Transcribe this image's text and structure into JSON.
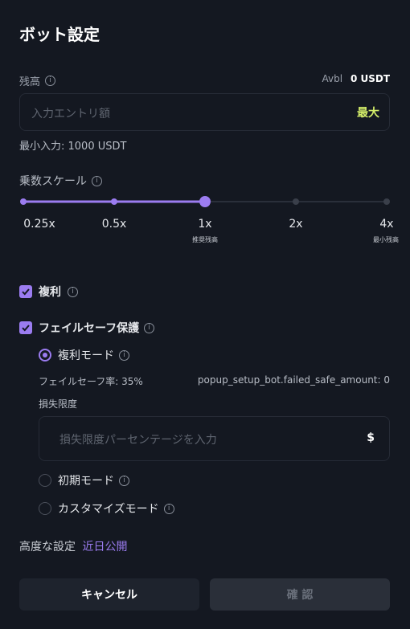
{
  "header": {
    "title": "ボット設定"
  },
  "balance": {
    "label": "残高",
    "avbl_label": "Avbl",
    "avbl_value": "0 USDT"
  },
  "amount_input": {
    "placeholder": "入力エントリ額",
    "max_label": "最大",
    "min_text": "最小入力: 1000 USDT"
  },
  "multiplier": {
    "label": "乗数スケール",
    "ticks": [
      "0.25x",
      "0.5x",
      "1x",
      "2x",
      "4x"
    ],
    "tick_notes": {
      "1x": "推奨残高",
      "4x": "最小残高"
    },
    "selected": "1x",
    "selected_index": 2
  },
  "compound": {
    "label": "複利",
    "checked": true
  },
  "failsafe": {
    "label": "フェイルセーフ保護",
    "checked": true,
    "modes": [
      {
        "label": "複利モード",
        "selected": true
      },
      {
        "label": "初期モード",
        "selected": false
      },
      {
        "label": "カスタマイズモード",
        "selected": false
      }
    ],
    "rate_text": "フェイルセーフ率: 35%",
    "amount_text": "popup_setup_bot.failed_safe_amount: 0",
    "loss_limit_label": "損失限度",
    "loss_limit_placeholder": "損失限度パーセンテージを入力",
    "currency_symbol": "$"
  },
  "advanced": {
    "label": "高度な設定",
    "link": "近日公開"
  },
  "buttons": {
    "cancel": "キャンセル",
    "confirm": "確 認"
  },
  "colors": {
    "accent": "#9b7cf0",
    "max_yellow": "#d6f06a",
    "background": "#141821"
  }
}
